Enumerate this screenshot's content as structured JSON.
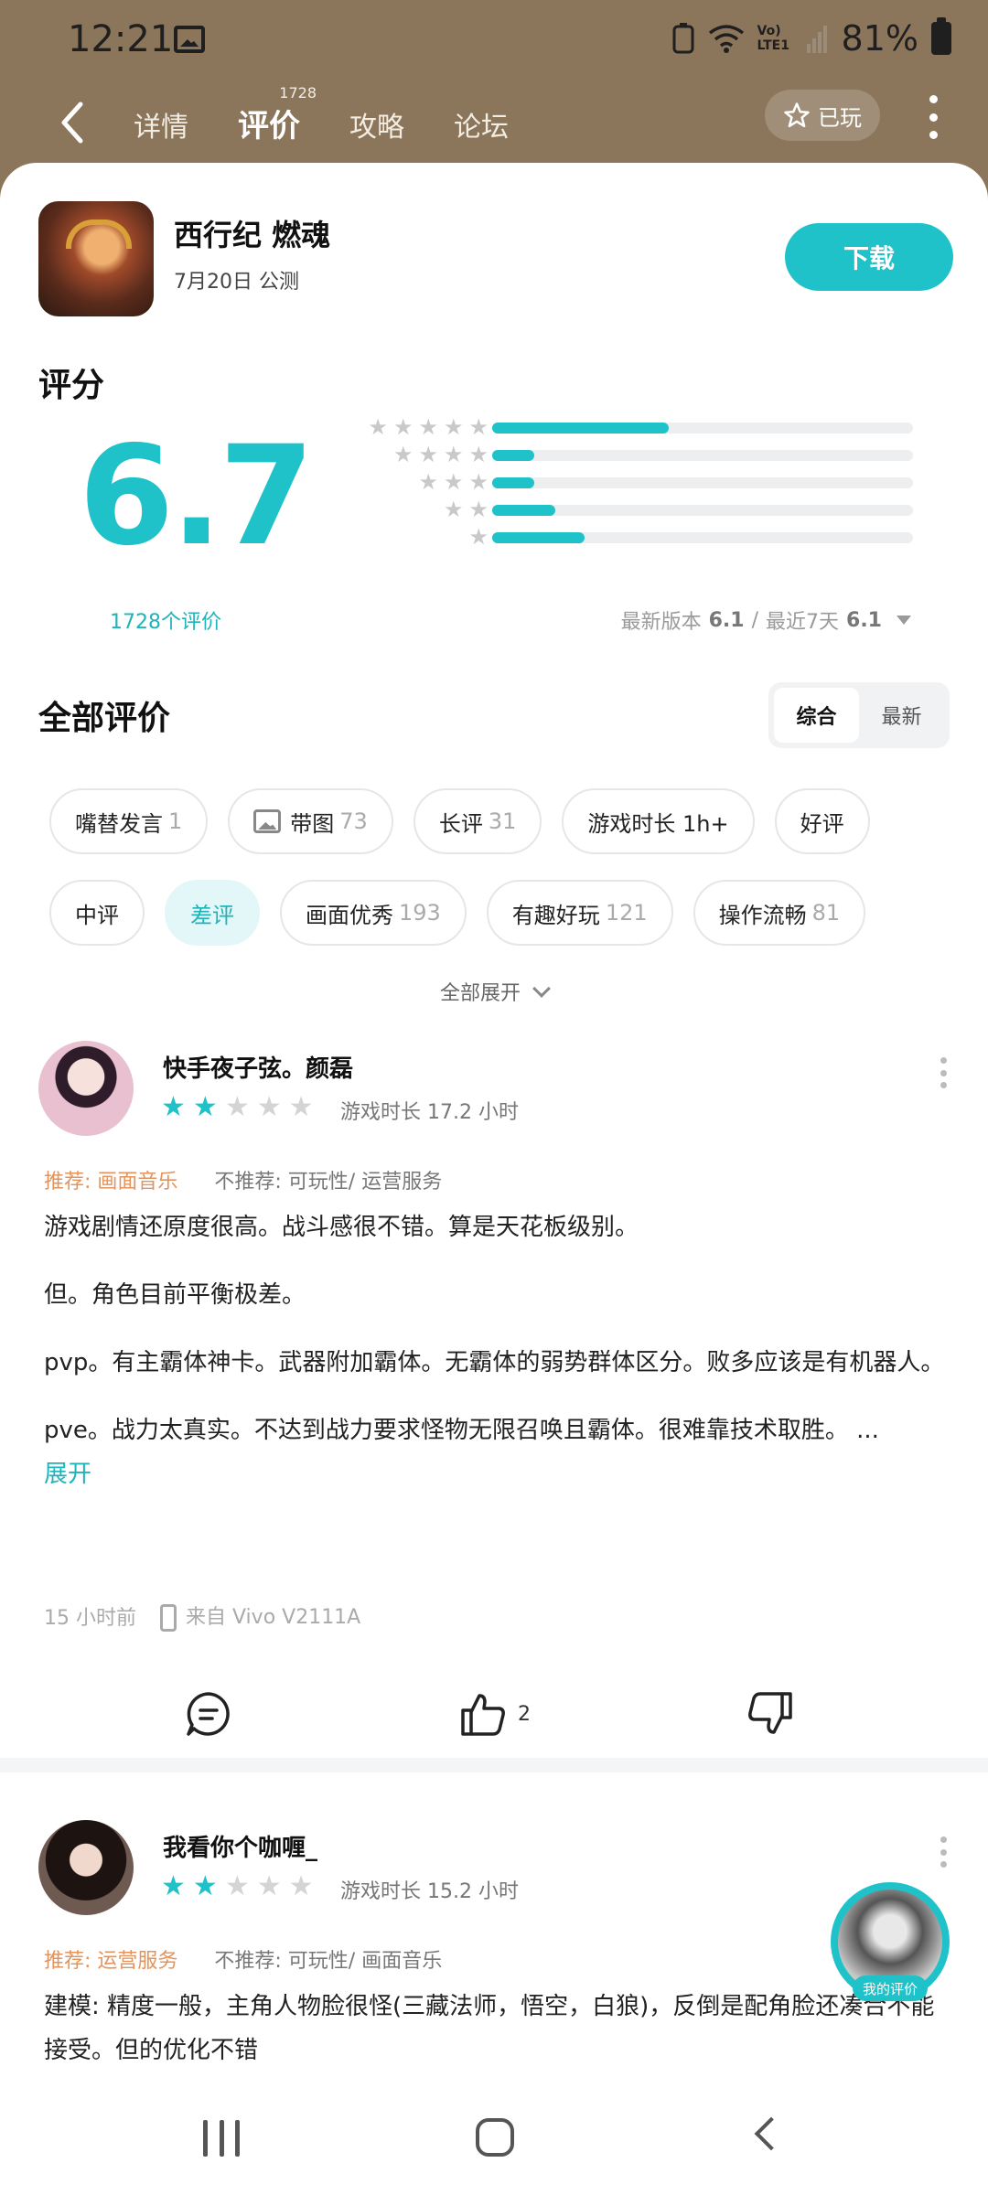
{
  "status_bar": {
    "time": "12:21",
    "network": "Vo) LTE1",
    "battery": "81%"
  },
  "nav": {
    "tabs": [
      {
        "label": "详情"
      },
      {
        "label": "评价",
        "badge": "1728"
      },
      {
        "label": "攻略"
      },
      {
        "label": "论坛"
      }
    ],
    "played_label": "已玩"
  },
  "game": {
    "title": "西行纪 燃魂",
    "subtitle": "7月20日 公测",
    "download_label": "下载"
  },
  "rating": {
    "label": "评分",
    "score": "6.7",
    "count_text": "1728个评价",
    "distribution": [
      {
        "stars": 5,
        "fraction": 0.42
      },
      {
        "stars": 4,
        "fraction": 0.1
      },
      {
        "stars": 3,
        "fraction": 0.1
      },
      {
        "stars": 2,
        "fraction": 0.15
      },
      {
        "stars": 1,
        "fraction": 0.22
      }
    ],
    "latest_version_label": "最新版本",
    "latest_version_score": "6.1",
    "separator": "/",
    "recent_label": "最近7天",
    "recent_score": "6.1"
  },
  "reviews_section": {
    "title": "全部评价",
    "sort_options": [
      "综合",
      "最新"
    ],
    "active_sort": "综合",
    "chips_row1": [
      {
        "label": "嘴替发言",
        "count": "1"
      },
      {
        "label": "带图",
        "count": "73",
        "icon": "image-icon"
      },
      {
        "label": "长评",
        "count": "31"
      },
      {
        "label": "游戏时长 1h+",
        "count": ""
      },
      {
        "label": "好评",
        "count": ""
      }
    ],
    "chips_row2": [
      {
        "label": "中评",
        "count": ""
      },
      {
        "label": "差评",
        "count": "",
        "selected": true
      },
      {
        "label": "画面优秀",
        "count": "193"
      },
      {
        "label": "有趣好玩",
        "count": "121"
      },
      {
        "label": "操作流畅",
        "count": "81"
      }
    ],
    "expand_all": "全部展开"
  },
  "reviews": [
    {
      "name": "快手夜子弦。颜磊",
      "stars": 2,
      "playtime": "游戏时长 17.2 小时",
      "recommend": "推荐: 画面音乐",
      "not_recommend": "不推荐: 可玩性/ 运营服务",
      "paragraphs": [
        "游戏剧情还原度很高。战斗感很不错。算是天花板级别。",
        "但。角色目前平衡极差。",
        "pvp。有主霸体神卡。武器附加霸体。无霸体的弱势群体区分。败多应该是有机器人。",
        "pve。战力太真实。不达到战力要求怪物无限召唤且霸体。很难靠技术取胜。 ..."
      ],
      "expand": "展开",
      "time": "15 小时前",
      "device": "来自 Vivo V2111A",
      "likes": "2"
    },
    {
      "name": "我看你个咖喱_",
      "stars": 2,
      "playtime": "游戏时长 15.2 小时",
      "recommend": "推荐: 运营服务",
      "not_recommend": "不推荐: 可玩性/ 画面音乐",
      "text": "建模: 精度一般，主角人物脸很怪(三藏法师，悟空，白狼)，反倒是配角脸还凑合不能接受。但的优化不错"
    }
  ],
  "my_review_label": "我的评价",
  "colors": {
    "accent": "#1fc2c9",
    "header_bg": "#8b765b",
    "recommend": "#e3935b"
  }
}
